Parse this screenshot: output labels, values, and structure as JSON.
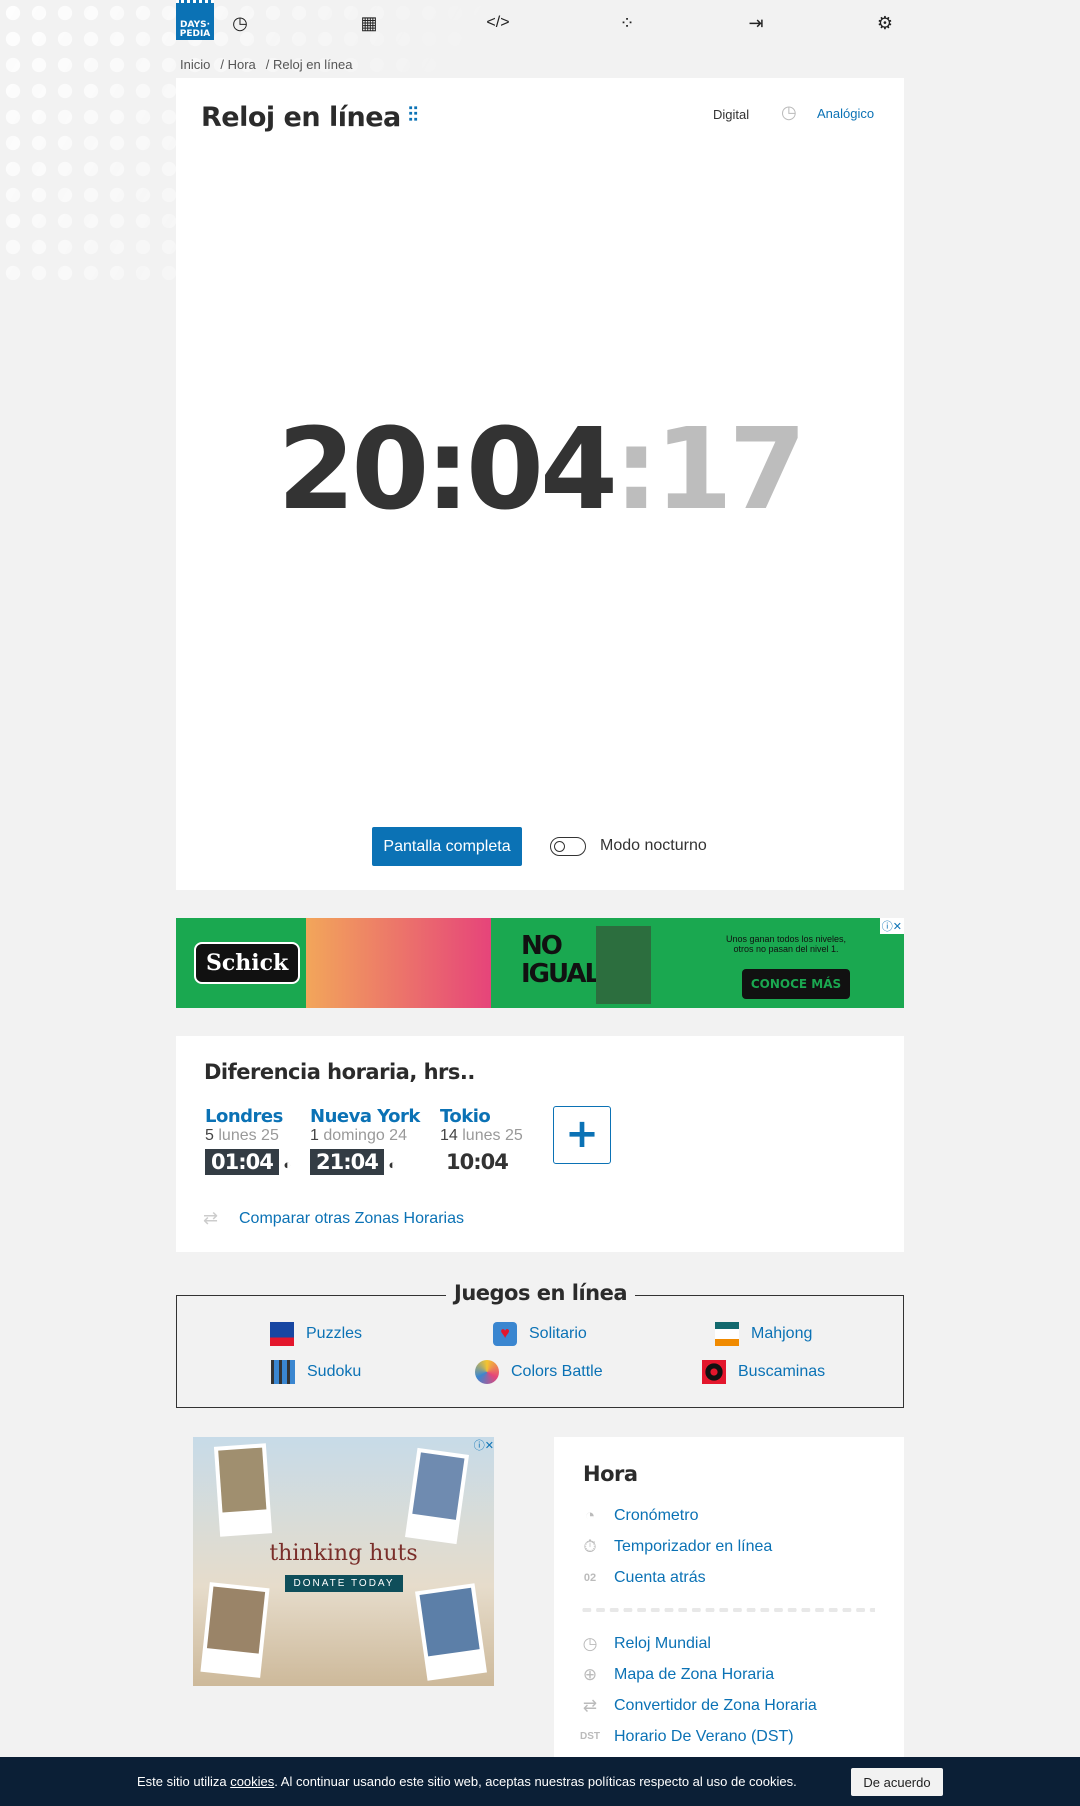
{
  "logo": {
    "line1": "DAYS·",
    "line2": "PEDIA"
  },
  "nav": [
    {
      "icon": "clock-icon",
      "glyph": "◷"
    },
    {
      "icon": "calendar-icon",
      "glyph": "▦"
    },
    {
      "icon": "code-icon",
      "glyph": "</>"
    },
    {
      "icon": "games-icon",
      "glyph": "⁘"
    },
    {
      "icon": "login-icon",
      "glyph": "⇥"
    },
    {
      "icon": "gear-icon",
      "glyph": "⚙"
    }
  ],
  "breadcrumb": [
    "Inicio",
    "/ Hora",
    "/ Reloj en línea"
  ],
  "clock_card": {
    "title": "Reloj en línea",
    "mode_digital": "Digital",
    "mode_analog": "Analógico",
    "time_hm": "20:04",
    "time_sep": ":",
    "time_s": "17",
    "fullscreen": "Pantalla completa",
    "night_mode": "Modo nocturno"
  },
  "ad1": {
    "brand": "Schick",
    "headline": "NO IGUALES",
    "tagline": "Unos ganan todos los niveles, otros no pasan del nivel 1.",
    "cta": "CONOCE MÁS"
  },
  "diff": {
    "title": "Diferencia horaria, hrs..",
    "cities": [
      {
        "name": "Londres",
        "offset": "5",
        "day": "lunes 25",
        "time": "01:04"
      },
      {
        "name": "Nueva York",
        "offset": "1",
        "day": "domingo 24",
        "time": "21:04"
      },
      {
        "name": "Tokio",
        "offset": "14",
        "day": "lunes 25",
        "time": "10:04"
      }
    ],
    "add": "+",
    "compare": "Comparar otras Zonas Horarias"
  },
  "games": {
    "title": "Juegos en línea",
    "items": [
      "Puzzles",
      "Solitario",
      "Mahjong",
      "Sudoku",
      "Colors Battle",
      "Buscaminas"
    ]
  },
  "ad2": {
    "brand": "thinking huts",
    "cta": "DONATE TODAY"
  },
  "hora": {
    "title": "Hora",
    "items": [
      "Cronómetro",
      "Temporizador en línea",
      "Cuenta atrás"
    ],
    "items2": [
      "Reloj Mundial",
      "Mapa de Zona Horaria",
      "Convertidor de Zona Horaria",
      "Horario De Verano (DST)"
    ]
  },
  "cookie": {
    "pre": "Este sitio utiliza ",
    "link": "cookies",
    "post": ". Al continuar usando este sitio web, aceptas nuestras políticas respecto al uso de cookies.",
    "accept": "De acuerdo"
  }
}
